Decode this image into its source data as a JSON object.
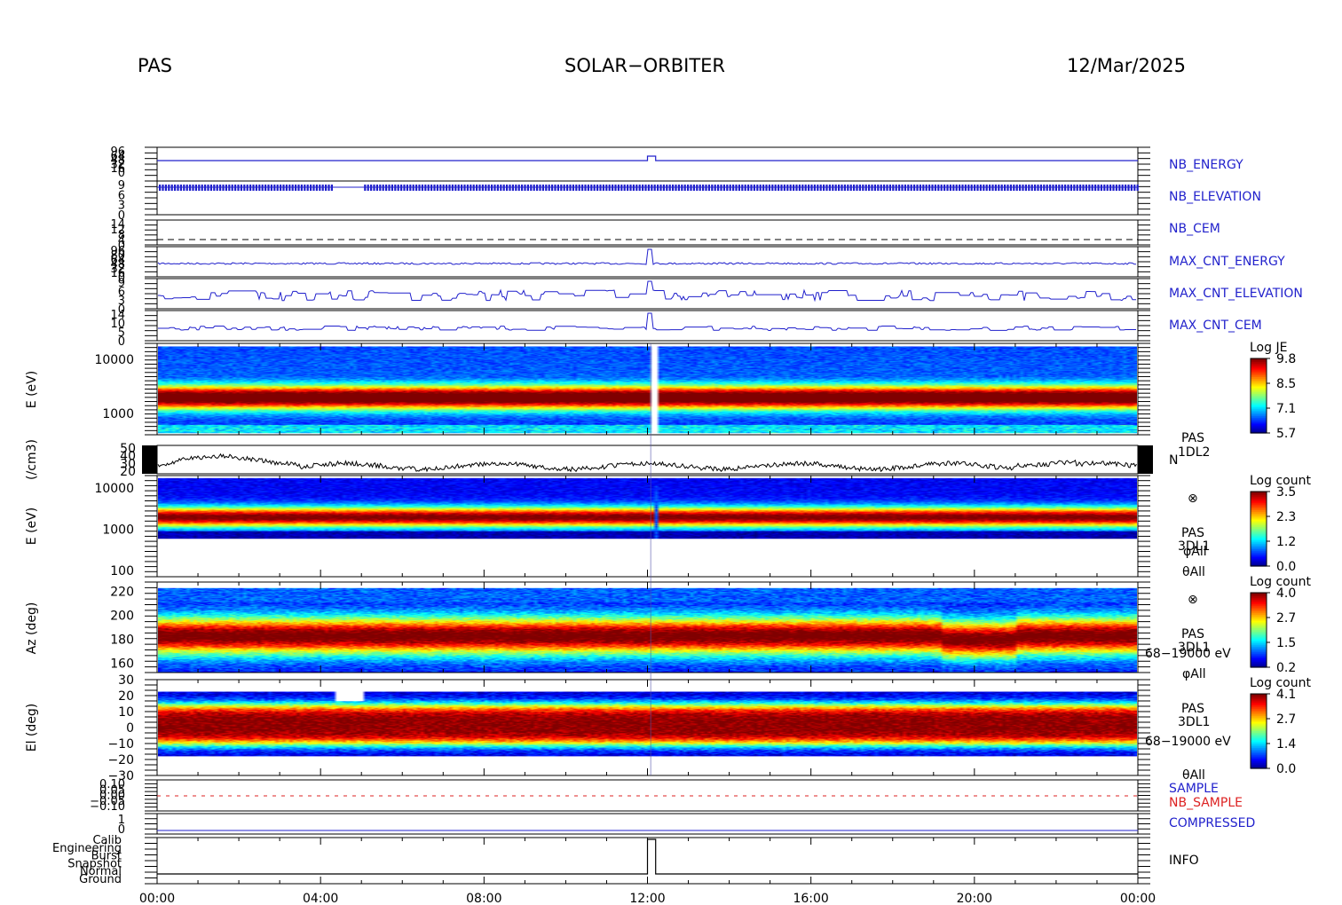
{
  "header": {
    "instrument": "PAS",
    "mission": "SOLAR−ORBITER",
    "date": "12/Mar/2025"
  },
  "colors": {
    "blue_trace": "#2020cc",
    "red_trace": "#dd2222",
    "spectrogram_scale": [
      "#0000aa",
      "#0000ff",
      "#00aaff",
      "#00ffaa",
      "#55ff00",
      "#ccff00",
      "#ffcc00",
      "#ff6600",
      "#ee0000"
    ]
  },
  "chart_data": {
    "type": "heatmap",
    "time_axis": {
      "start": "00:00",
      "end": "00:00",
      "range_hours": [
        0,
        24
      ],
      "tick_labels": [
        "00:00",
        "04:00",
        "08:00",
        "12:00",
        "16:00",
        "20:00",
        "00:00"
      ],
      "tick_hours": [
        0,
        4,
        8,
        12,
        16,
        20,
        24
      ]
    },
    "panels": [
      {
        "id": "nb_energy",
        "type": "line",
        "label": "NB_ENERGY",
        "label_color": "#2222cc",
        "tick_labels": [
          "96",
          "64",
          "48",
          "32",
          "16",
          "0"
        ],
        "baseline_level": 0,
        "step": {
          "start_hour": 12.0,
          "end_hour": 12.2,
          "value": "96"
        }
      },
      {
        "id": "nb_elevation",
        "type": "line",
        "label": "NB_ELEVATION",
        "label_color": "#2222cc",
        "tick_labels": [
          "9",
          "6",
          "3",
          "0"
        ],
        "base_level": "6",
        "gap": {
          "start_hour": 4.3,
          "end_hour": 5.0
        }
      },
      {
        "id": "nb_cem",
        "type": "line",
        "label": "NB_CEM",
        "label_color": "#2222cc",
        "tick_labels": [
          "14",
          "12",
          "8",
          "4",
          "0"
        ],
        "level": "4",
        "dashed": true
      },
      {
        "id": "max_cnt_energy",
        "type": "line",
        "label": "MAX_CNT_ENERGY",
        "label_color": "#2222cc",
        "tick_labels": [
          "96",
          "80",
          "64",
          "48",
          "32",
          "16",
          "0"
        ],
        "typical_level": 32
      },
      {
        "id": "max_cnt_elevation",
        "type": "line",
        "label": "MAX_CNT_ELEVATION",
        "label_color": "#2222cc",
        "tick_labels": [
          "9",
          "6",
          "3",
          "0"
        ],
        "typical_range": [
          2,
          5
        ]
      },
      {
        "id": "max_cnt_cem",
        "type": "line",
        "label": "MAX_CNT_CEM",
        "label_color": "#2222cc",
        "tick_labels": [
          "14",
          "10",
          "5",
          "0"
        ],
        "typical_range": [
          4,
          6
        ]
      },
      {
        "id": "je_spectrogram",
        "type": "heatmap",
        "ylabel": "E (eV)",
        "yscale": "log",
        "y_tick_labels": [
          "10000",
          "1000"
        ],
        "y_tick_values": [
          10000,
          1000
        ],
        "ylim": [
          400,
          20000
        ],
        "peak_energy_eV": 2000,
        "colorbar": {
          "title": "Log JE",
          "ticks": [
            "9.8",
            "8.5",
            "7.1",
            "5.7"
          ],
          "range": [
            5.7,
            9.8
          ]
        }
      },
      {
        "id": "density",
        "type": "line",
        "ylabel": "(/cm3)",
        "y_tick_labels": [
          "50",
          "40",
          "30",
          "20"
        ],
        "ylim": [
          20,
          50
        ],
        "right_labels": [
          "PAS",
          "1DL2",
          "N"
        ],
        "typical_value": 28
      },
      {
        "id": "energy_spectrogram",
        "type": "heatmap",
        "ylabel": "E (eV)",
        "yscale": "log",
        "y_tick_labels": [
          "10000",
          "1000",
          "100"
        ],
        "y_tick_values": [
          10000,
          1000,
          100
        ],
        "ylim": [
          70,
          20000
        ],
        "peak_energy_eV": 2000,
        "right_labels": [
          "⊗",
          "PAS",
          "3DL1",
          "φAll",
          "θAll"
        ],
        "colorbar": {
          "title": "Log count",
          "ticks": [
            "3.5",
            "2.3",
            "1.2",
            "0.0"
          ],
          "range": [
            0.0,
            3.5
          ]
        }
      },
      {
        "id": "azimuth_spectrogram",
        "type": "heatmap",
        "ylabel": "Az (deg)",
        "y_tick_labels": [
          "220",
          "200",
          "180",
          "160"
        ],
        "y_tick_values": [
          220,
          200,
          180,
          160
        ],
        "ylim": [
          152,
          228
        ],
        "peak_azimuth_deg": 183,
        "right_labels": [
          "⊗",
          "PAS",
          "3DL1",
          "68−19000 eV",
          "φAll"
        ],
        "colorbar": {
          "title": "Log count",
          "ticks": [
            "4.0",
            "2.7",
            "1.5",
            "0.2"
          ],
          "range": [
            0.2,
            4.0
          ]
        }
      },
      {
        "id": "elevation_spectrogram",
        "type": "heatmap",
        "ylabel": "El (deg)",
        "y_tick_labels": [
          "30",
          "20",
          "10",
          "0",
          "−10",
          "−20",
          "−30"
        ],
        "y_tick_values": [
          30,
          20,
          10,
          0,
          -10,
          -20,
          -30
        ],
        "ylim": [
          -30,
          30
        ],
        "peak_elevation_deg": 2,
        "right_labels": [
          "PAS",
          "3DL1",
          "68−19000 eV",
          "θAll"
        ],
        "colorbar": {
          "title": "Log count",
          "ticks": [
            "4.1",
            "2.7",
            "1.4",
            "0.0"
          ],
          "range": [
            0.0,
            4.1
          ]
        }
      },
      {
        "id": "sample",
        "type": "line",
        "labels": [
          "SAMPLE",
          "NB_SAMPLE"
        ],
        "label_colors": [
          "#2222cc",
          "#dd2222"
        ],
        "tick_labels": [
          "0.10",
          "0.05",
          "0.00",
          "−0.05",
          "−0.10"
        ],
        "level": 0.0
      },
      {
        "id": "compressed",
        "type": "line",
        "label": "COMPRESSED",
        "label_color": "#2222cc",
        "tick_labels": [
          "1",
          "0"
        ],
        "level": 0
      },
      {
        "id": "info",
        "type": "line",
        "label": "INFO",
        "label_color": "#000000",
        "tick_labels": [
          "Calib",
          "Engineering",
          "Burst",
          "Snapshot",
          "Normal",
          "Ground"
        ],
        "base_state": "Normal",
        "step": {
          "start_hour": 12.0,
          "end_hour": 12.2,
          "value": "Calib"
        }
      }
    ]
  }
}
